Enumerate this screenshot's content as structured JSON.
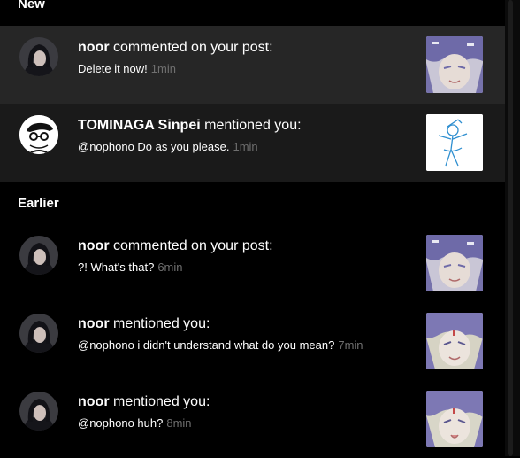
{
  "sections": {
    "new_label": "New",
    "earlier_label": "Earlier"
  },
  "notifications": [
    {
      "user": "noor",
      "action": "commented on your post:",
      "message": "Delete it now!",
      "time": "1min",
      "avatar": "dark-haired-girl-avatar",
      "thumbnail": "anime-drawing-thumbnail",
      "highlighted": true
    },
    {
      "user": "TOMINAGA Sinpei",
      "action": "mentioned you:",
      "message": "@nophono Do as you please.",
      "time": "1min",
      "avatar": "glasses-sketch-avatar",
      "thumbnail": "blue-sketch-thumbnail",
      "highlighted": true
    },
    {
      "user": "noor",
      "action": "commented on your post:",
      "message": "?! What's that?",
      "time": "6min",
      "avatar": "dark-haired-girl-avatar",
      "thumbnail": "anime-drawing-thumbnail",
      "highlighted": false
    },
    {
      "user": "noor",
      "action": "mentioned you:",
      "message": "@nophono i didn't understand what do you mean?",
      "time": "7min",
      "avatar": "dark-haired-girl-avatar",
      "thumbnail": "anime-drawing-thumbnail",
      "highlighted": false
    },
    {
      "user": "noor",
      "action": "mentioned you:",
      "message": "@nophono huh?",
      "time": "8min",
      "avatar": "dark-haired-girl-avatar",
      "thumbnail": "anime-drawing-thumbnail",
      "highlighted": false
    }
  ],
  "colors": {
    "background": "#000000",
    "row_highlight_1": "#262626",
    "row_highlight_2": "#1a1a1a",
    "text": "#ffffff",
    "muted": "#6f6f6f"
  }
}
